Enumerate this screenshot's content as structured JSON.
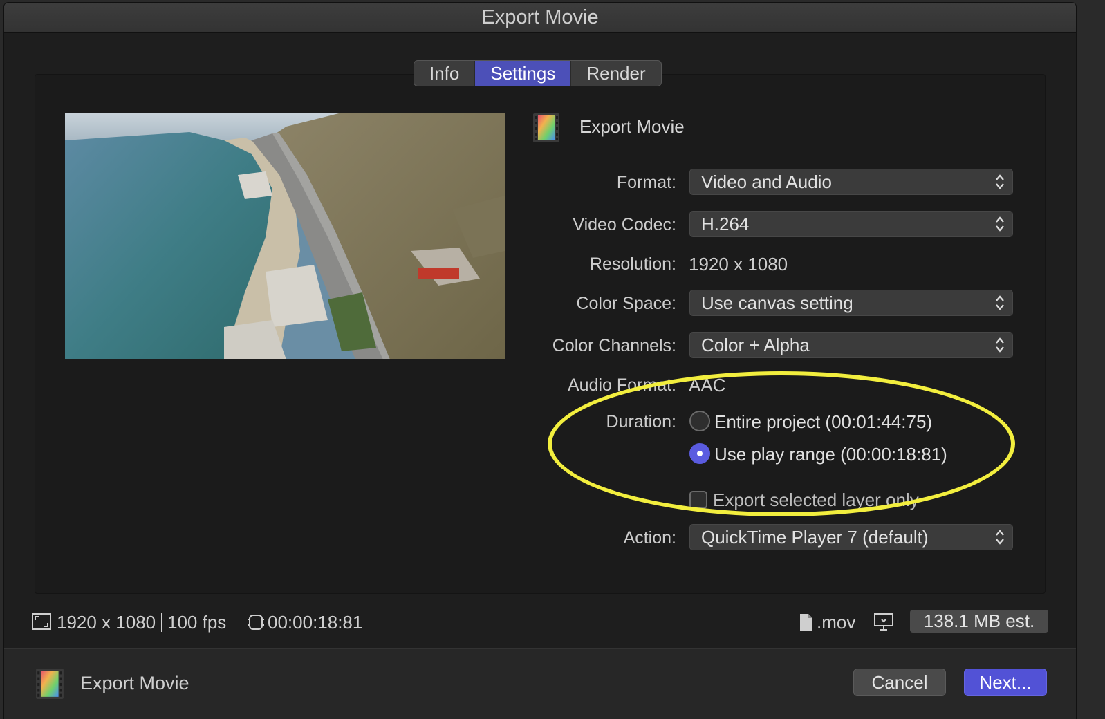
{
  "window": {
    "title": "Export Movie"
  },
  "tabs": [
    {
      "label": "Info",
      "active": false
    },
    {
      "label": "Settings",
      "active": true
    },
    {
      "label": "Render",
      "active": false
    }
  ],
  "header": {
    "title": "Export Movie",
    "icon": "film-strip-icon"
  },
  "settings": {
    "format": {
      "label": "Format:",
      "value": "Video and Audio"
    },
    "video_codec": {
      "label": "Video Codec:",
      "value": "H.264"
    },
    "resolution": {
      "label": "Resolution:",
      "value": "1920 x 1080"
    },
    "color_space": {
      "label": "Color Space:",
      "value": "Use canvas setting"
    },
    "color_channels": {
      "label": "Color Channels:",
      "value": "Color + Alpha"
    },
    "audio_format": {
      "label": "Audio Format:",
      "value": "AAC"
    },
    "duration": {
      "label": "Duration:",
      "options": [
        {
          "label": "Entire project (00:01:44:75)",
          "selected": false
        },
        {
          "label": "Use play range (00:00:18:81)",
          "selected": true
        }
      ]
    },
    "export_selected": {
      "label": "Export selected layer only",
      "checked": false
    },
    "action": {
      "label": "Action:",
      "value": "QuickTime Player 7 (default)"
    }
  },
  "status": {
    "resolution": "1920 x 1080",
    "fps": "100 fps",
    "duration": "00:00:18:81",
    "extension": ".mov",
    "size_estimate": "138.1 MB est."
  },
  "footer": {
    "title": "Export Movie",
    "cancel_label": "Cancel",
    "next_label": "Next..."
  },
  "colors": {
    "accent": "#5252d6",
    "highlight_ellipse": "#f2ee3e",
    "background": "#1e1e1e"
  }
}
